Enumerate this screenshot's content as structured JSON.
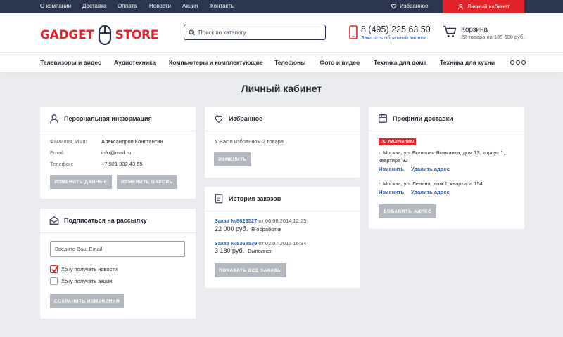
{
  "topbar": {
    "links": [
      "О компании",
      "Доставка",
      "Оплата",
      "Новости",
      "Акции",
      "Контакты"
    ],
    "favorites": "Избранное",
    "cabinet": "Личный кабинет"
  },
  "header": {
    "logo_left": "GADGET",
    "logo_right": "STORE",
    "search_placeholder": "Поиск по каталогу",
    "phone": "8 (495) 225 63 50",
    "callback": "Заказать обратный звонок",
    "cart_title": "Корзина",
    "cart_info": "22 товара на 135 600 руб."
  },
  "nav": [
    "Телевизоры и видео",
    "Аудиотехника",
    "Компьютеры и комплектующие",
    "Телефоны",
    "Фото и видео",
    "Техника для дома",
    "Техника для кухни"
  ],
  "page_title": "Личный кабинет",
  "personal": {
    "title": "Персональная информация",
    "name_label": "Фамилия, Имя:",
    "name_value": "Александров Константин",
    "email_label": "Email:",
    "email_value": "info@mail.ru",
    "phone_label": "Телефон:",
    "phone_value": "+7 921 332 43 55",
    "edit_btn": "Изменить данные",
    "password_btn": "Изменить пароль"
  },
  "subscribe": {
    "title": "Подписаться на рассылку",
    "email_placeholder": "Введите Ваш Email",
    "news_label": "Хочу получать новости",
    "news_checked": true,
    "promo_label": "Хочу получать акции",
    "promo_checked": false,
    "save_btn": "Сохранить изменения"
  },
  "favorites": {
    "title": "Избранное",
    "text": "У Вас в избранном 2 товара",
    "edit_btn": "Изменить"
  },
  "orders": {
    "title": "История заказов",
    "items": [
      {
        "link": "Заказ №8623527",
        "date": " от 06.08.2014 12:25",
        "price": "22 000 руб.",
        "status": "В обработке"
      },
      {
        "link": "Заказ №5368539",
        "date": " от 02.07.2013 16:34",
        "price": "3 180 руб.",
        "status": "Выполнен"
      }
    ],
    "show_all_btn": "Показать все заказы"
  },
  "delivery": {
    "title": "Профили доставки",
    "default_badge": "По умолчанию",
    "addresses": [
      {
        "text": "г. Москва, ул. Большая Якиманка, дом 13, корпус 1, квартира 92",
        "edit": "Изменить",
        "delete": "Удалить адрес"
      },
      {
        "text": "г. Москва, ул. Ленина, дом 1, квартира 154",
        "edit": "Изменить",
        "delete": "Удалить адрес"
      }
    ],
    "add_btn": "Добавить адрес"
  },
  "colors": {
    "navy": "#2c3550",
    "red": "#e3232a",
    "link": "#2f5aa8",
    "button_gray": "#b3b8c0",
    "background": "#e9ebee"
  },
  "icons": [
    "heart-icon",
    "user-icon",
    "mouse-icon",
    "search-icon",
    "phone-icon",
    "cart-icon",
    "more-dots-icon",
    "mail-icon",
    "checkmark-icon",
    "order-history-icon",
    "delivery-box-icon"
  ]
}
